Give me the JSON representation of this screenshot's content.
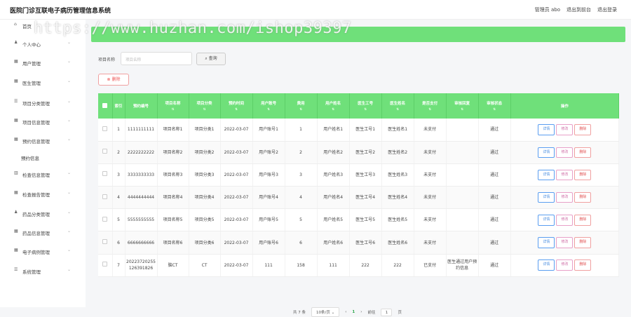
{
  "header": {
    "title": "医院门诊互联电子病历管理信息系统",
    "admin": "管理员 abo",
    "back_to_front": "退出到前台",
    "logout": "退出登录"
  },
  "watermark": "https://www.huzhan.com/ishop39397",
  "sidebar": {
    "items": [
      {
        "label": "首页",
        "icon": "home-icon"
      },
      {
        "label": "个人中心",
        "icon": "user-icon"
      },
      {
        "label": "用户管理",
        "icon": "grid-icon"
      },
      {
        "label": "医生管理",
        "icon": "grid-icon"
      },
      {
        "label": "项目分类管理",
        "icon": "list-icon"
      },
      {
        "label": "项目信息管理",
        "icon": "grid-icon"
      },
      {
        "label": "预约信息管理",
        "icon": "grid-icon"
      },
      {
        "label": "预约信息",
        "icon": ""
      },
      {
        "label": "检查信息管理",
        "icon": "chart-icon"
      },
      {
        "label": "检查报告管理",
        "icon": "grid-icon"
      },
      {
        "label": "药品分类管理",
        "icon": "user-icon"
      },
      {
        "label": "药品信息管理",
        "icon": "grid-icon"
      },
      {
        "label": "电子病例管理",
        "icon": "grid-icon"
      },
      {
        "label": "系统管理",
        "icon": "list-icon"
      }
    ]
  },
  "search": {
    "label": "项目名称",
    "placeholder": "项目名称",
    "button": "查询"
  },
  "delete_button": "删除",
  "table": {
    "columns": [
      "索引",
      "预约编号",
      "项目名称",
      "项目分类",
      "预约时间",
      "用户账号",
      "费用",
      "用户姓名",
      "医生工号",
      "医生姓名",
      "是否支付",
      "审核回复",
      "审核状态",
      "操作"
    ],
    "rows": [
      {
        "idx": "1",
        "no": "1111111111",
        "name": "项目名称1",
        "cat": "项目分类1",
        "time": "2022-03-07",
        "acct": "用户账号1",
        "fee": "1",
        "uname": "用户姓名1",
        "docno": "医生工号1",
        "doc": "医生姓名1",
        "paid": "未支付",
        "reply": "",
        "status": "通过"
      },
      {
        "idx": "2",
        "no": "2222222222",
        "name": "项目名称2",
        "cat": "项目分类2",
        "time": "2022-03-07",
        "acct": "用户账号2",
        "fee": "2",
        "uname": "用户姓名2",
        "docno": "医生工号2",
        "doc": "医生姓名2",
        "paid": "未支付",
        "reply": "",
        "status": "通过"
      },
      {
        "idx": "3",
        "no": "3333333333",
        "name": "项目名称3",
        "cat": "项目分类3",
        "time": "2022-03-07",
        "acct": "用户账号3",
        "fee": "3",
        "uname": "用户姓名3",
        "docno": "医生工号3",
        "doc": "医生姓名3",
        "paid": "未支付",
        "reply": "",
        "status": "通过"
      },
      {
        "idx": "4",
        "no": "4444444444",
        "name": "项目名称4",
        "cat": "项目分类4",
        "time": "2022-03-07",
        "acct": "用户账号4",
        "fee": "4",
        "uname": "用户姓名4",
        "docno": "医生工号4",
        "doc": "医生姓名4",
        "paid": "未支付",
        "reply": "",
        "status": "通过"
      },
      {
        "idx": "5",
        "no": "5555555555",
        "name": "项目名称5",
        "cat": "项目分类5",
        "time": "2022-03-07",
        "acct": "用户账号5",
        "fee": "5",
        "uname": "用户姓名5",
        "docno": "医生工号5",
        "doc": "医生姓名5",
        "paid": "未支付",
        "reply": "",
        "status": "通过"
      },
      {
        "idx": "6",
        "no": "6666666666",
        "name": "项目名称6",
        "cat": "项目分类6",
        "time": "2022-03-07",
        "acct": "用户账号6",
        "fee": "6",
        "uname": "用户姓名6",
        "docno": "医生工号6",
        "doc": "医生姓名6",
        "paid": "未支付",
        "reply": "",
        "status": "通过"
      },
      {
        "idx": "7",
        "no": "20223720255126391826",
        "name": "脑CT",
        "cat": "CT",
        "time": "2022-03-07",
        "acct": "111",
        "fee": "158",
        "uname": "111",
        "docno": "222",
        "doc": "222",
        "paid": "已支付",
        "reply": "医生通过用户预约信息",
        "status": "通过"
      }
    ],
    "ops": {
      "detail": "详情",
      "edit": "修改",
      "delete": "删除"
    }
  },
  "pager": {
    "total": "共 7 条",
    "size": "10条/页",
    "prev": "‹",
    "current": "1",
    "next": "›",
    "goto": "前往",
    "page": "1",
    "unit": "页"
  },
  "colors": {
    "accent": "#6fe07a",
    "danger": "#e55555",
    "info": "#4a8ee0"
  }
}
